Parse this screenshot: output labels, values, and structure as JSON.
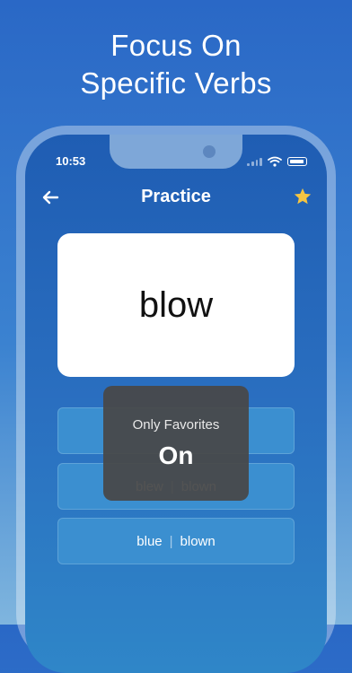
{
  "headline": {
    "line1": "Focus On",
    "line2": "Specific Verbs"
  },
  "status_bar": {
    "time": "10:53"
  },
  "nav": {
    "title": "Practice"
  },
  "card": {
    "word": "blow"
  },
  "options": [
    {
      "past": "",
      "participle": ""
    },
    {
      "past": "blew",
      "participle": "blown"
    },
    {
      "past": "blue",
      "participle": "blown"
    }
  ],
  "toast": {
    "label": "Only Favorites",
    "value": "On"
  },
  "colors": {
    "star": "#f5c542",
    "background_top": "#2a68c6",
    "toast_bg": "#484848"
  },
  "icons": {
    "back": "arrow-left-icon",
    "favorite": "star-icon",
    "wifi": "wifi-icon",
    "battery": "battery-icon",
    "signal": "signal-icon"
  }
}
